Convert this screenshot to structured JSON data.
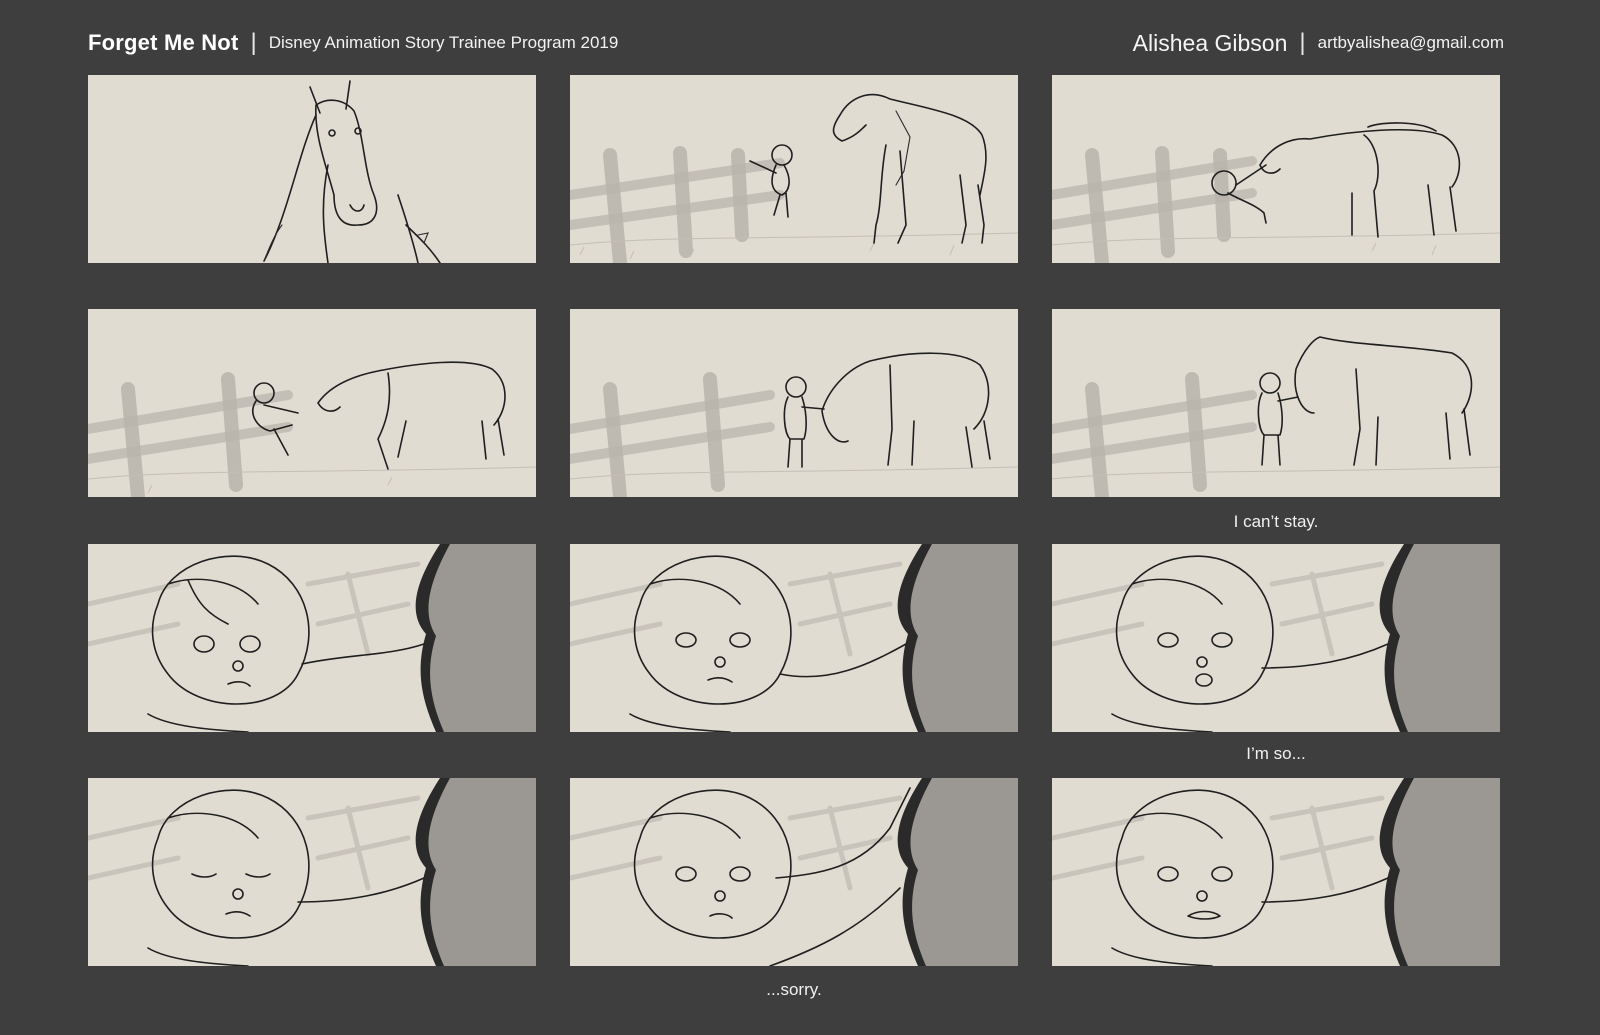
{
  "header": {
    "project_title": "Forget Me Not",
    "program": "Disney Animation Story Trainee Program 2019",
    "author": "Alishea Gibson",
    "email": "artbyalishea@gmail.com"
  },
  "captions": {
    "row2_panel3": "I can’t stay.",
    "row3_panel3": "I’m so...",
    "row4_panel2": "...sorry."
  },
  "colors": {
    "background": "#3e3e3e",
    "panel": "#e1dcd2",
    "sketch": "#1f1f1f",
    "horse_shadow": "#9b9792"
  }
}
